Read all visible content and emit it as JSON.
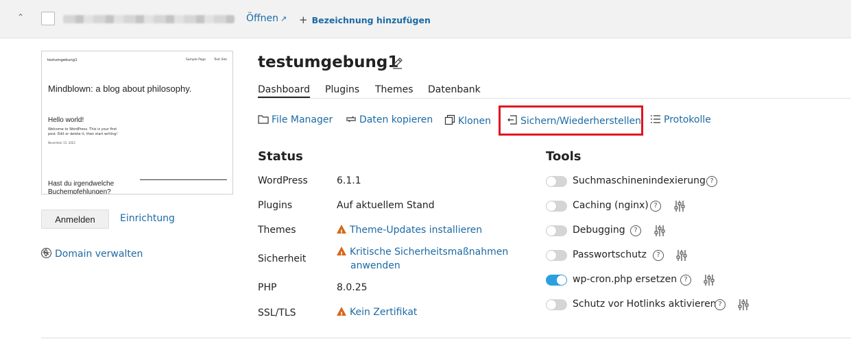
{
  "topbar": {
    "open_label": "Öffnen",
    "add_label": "Bezeichnung hinzufügen"
  },
  "preview": {
    "site_name": "testumgebung1",
    "nav": [
      "Sample Page",
      "Test Site"
    ],
    "headline": "Mindblown: a blog about philosophy.",
    "post_title": "Hello world!",
    "post_text": "Welcome to WordPress. This is your first post. Edit or delete it, then start writing!",
    "post_date": "November 15, 2022",
    "question": "Hast du irgendwelche Buchempfehlungen?"
  },
  "left": {
    "login_button": "Anmelden",
    "setup_link": "Einrichtung",
    "domain_link": "Domain verwalten"
  },
  "site": {
    "title": "testumgebung1"
  },
  "tabs": [
    "Dashboard",
    "Plugins",
    "Themes",
    "Datenbank"
  ],
  "actions": [
    "File Manager",
    "Daten kopieren",
    "Klonen",
    "Sichern/Wiederherstellen",
    "Protokolle"
  ],
  "status": {
    "title": "Status",
    "rows": [
      {
        "label": "WordPress",
        "value": "6.1.1"
      },
      {
        "label": "Plugins",
        "value": "Auf aktuellem Stand"
      },
      {
        "label": "Themes",
        "value": "Theme-Updates installieren"
      },
      {
        "label": "Sicherheit",
        "value": "Kritische Sicherheitsmaßnahmen anwenden"
      },
      {
        "label": "PHP",
        "value": "8.0.25"
      },
      {
        "label": "SSL/TLS",
        "value": "Kein Zertifikat"
      }
    ]
  },
  "tools": {
    "title": "Tools",
    "items": [
      {
        "label": "Suchmaschinenindexierung",
        "enabled": false
      },
      {
        "label": "Caching (nginx)",
        "enabled": false
      },
      {
        "label": "Debugging",
        "enabled": false
      },
      {
        "label": "Passwortschutz",
        "enabled": false
      },
      {
        "label": "wp-cron.php ersetzen",
        "enabled": true
      },
      {
        "label": "Schutz vor Hotlinks aktivieren",
        "enabled": false
      }
    ]
  },
  "colors": {
    "link": "#1b6aa5",
    "highlight": "#e0141e",
    "warning": "#d6681a",
    "toggle_on": "#2aa0e0"
  }
}
